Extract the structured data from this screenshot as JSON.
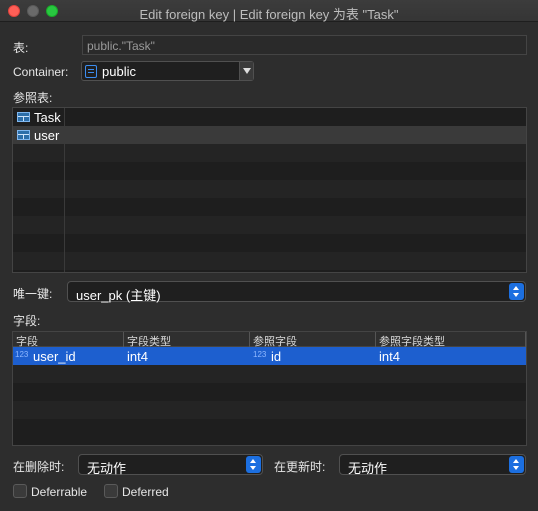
{
  "window": {
    "title": "Edit foreign key | Edit foreign key 为表 \"Task\""
  },
  "table_label": "表:",
  "table_value": "public.\"Task\"",
  "container": {
    "label": "Container:",
    "value": "public"
  },
  "ref_table": {
    "label": "参照表:",
    "items": [
      {
        "label": "Task",
        "selected": false
      },
      {
        "label": "user",
        "selected": true
      }
    ]
  },
  "unique_key": {
    "label": "唯一键:",
    "value": "user_pk (主键)"
  },
  "fields": {
    "label": "字段:",
    "columns": [
      "字段",
      "字段类型",
      "参照字段",
      "参照字段类型"
    ],
    "rows": [
      {
        "badge": "123",
        "field": "user_id",
        "type": "int4",
        "ref_badge": "123",
        "ref_field": "id",
        "ref_type": "int4"
      }
    ]
  },
  "on_delete": {
    "label": "在删除时:",
    "value": "无动作"
  },
  "on_update": {
    "label": "在更新时:",
    "value": "无动作"
  },
  "deferrable": {
    "label": "Deferrable"
  },
  "deferred": {
    "label": "Deferred"
  },
  "colors": {
    "accent": "#1c6fe0",
    "selection": "#1d5fcf",
    "close": "#fe5f57",
    "maximize": "#28c840"
  }
}
